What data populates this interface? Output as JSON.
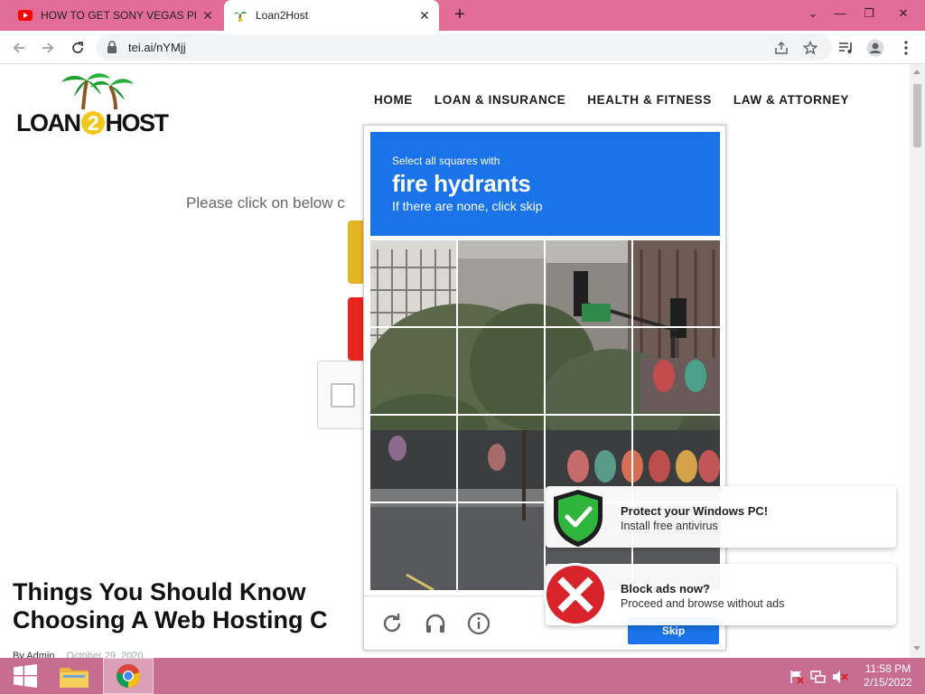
{
  "browser": {
    "tabs": [
      {
        "title": "HOW TO GET SONY VEGAS PRO",
        "favicon": "youtube-icon",
        "active": false
      },
      {
        "title": "Loan2Host",
        "favicon": "palm-tree-icon",
        "active": true
      }
    ],
    "url": "tei.ai/nYMjj",
    "tabbar_color": "#e46d98"
  },
  "site": {
    "logo": {
      "part1": "LOAN",
      "part2": "2",
      "part3": "HOST"
    },
    "nav": [
      "HOME",
      "LOAN & INSURANCE",
      "HEALTH & FITNESS",
      "LAW & ATTORNEY"
    ],
    "instruction": "Please click on below c",
    "article": {
      "title_line1": "Things You Should Know",
      "title_line2": "Choosing A Web Hosting C",
      "author": "By Admin",
      "date": "October 29, 2020"
    }
  },
  "captcha": {
    "prompt": "Select all squares with",
    "target": "fire hydrants",
    "hint": "If there are none, click skip",
    "grid": {
      "rows": 4,
      "cols": 4
    },
    "skip_label": "Skip",
    "icons": [
      "reload-icon",
      "audio-icon",
      "info-icon"
    ],
    "accent": "#1a73e8"
  },
  "notifications": [
    {
      "title": "Protect your Windows PC!",
      "body": "Install free antivirus",
      "icon": "green-shield-check-icon"
    },
    {
      "title": "Block ads now?",
      "body": "Proceed and browse without ads",
      "icon": "red-x-circle-icon"
    }
  ],
  "taskbar": {
    "time": "11:58 PM",
    "date": "2/15/2022",
    "color": "#c86d8f"
  }
}
